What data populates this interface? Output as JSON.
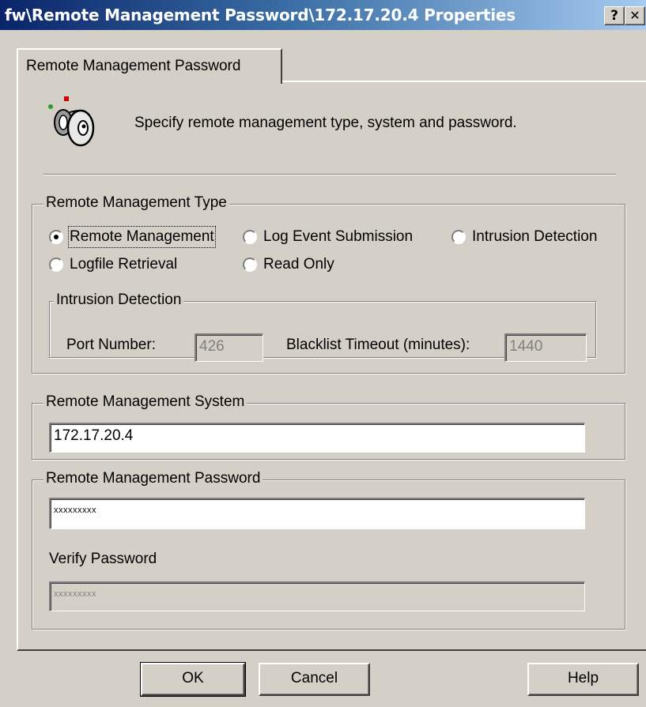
{
  "window": {
    "title": "fw\\Remote Management Password\\172.17.20.4 Properties",
    "help_button": "?",
    "close_button": "✕"
  },
  "tab": {
    "label": "Remote Management Password"
  },
  "header": {
    "icon": "key-icon",
    "description": "Specify remote management type, system and password."
  },
  "type_group": {
    "label": "Remote Management Type",
    "options": [
      {
        "label": "Remote Management",
        "selected": true
      },
      {
        "label": "Log Event Submission",
        "selected": false
      },
      {
        "label": "Intrusion Detection",
        "selected": false
      },
      {
        "label": "Logfile Retrieval",
        "selected": false
      },
      {
        "label": "Read Only",
        "selected": false
      }
    ],
    "intrusion": {
      "label": "Intrusion Detection",
      "port_label": "Port Number:",
      "port_value": "426",
      "timeout_label": "Blacklist Timeout (minutes):",
      "timeout_value": "1440"
    }
  },
  "system_group": {
    "label": "Remote Management System",
    "value": "172.17.20.4"
  },
  "password_group": {
    "label": "Remote Management Password",
    "value": "xxxxxxxxx",
    "verify_label": "Verify Password",
    "verify_value": "xxxxxxxxx"
  },
  "buttons": {
    "ok": "OK",
    "cancel": "Cancel",
    "help": "Help"
  }
}
